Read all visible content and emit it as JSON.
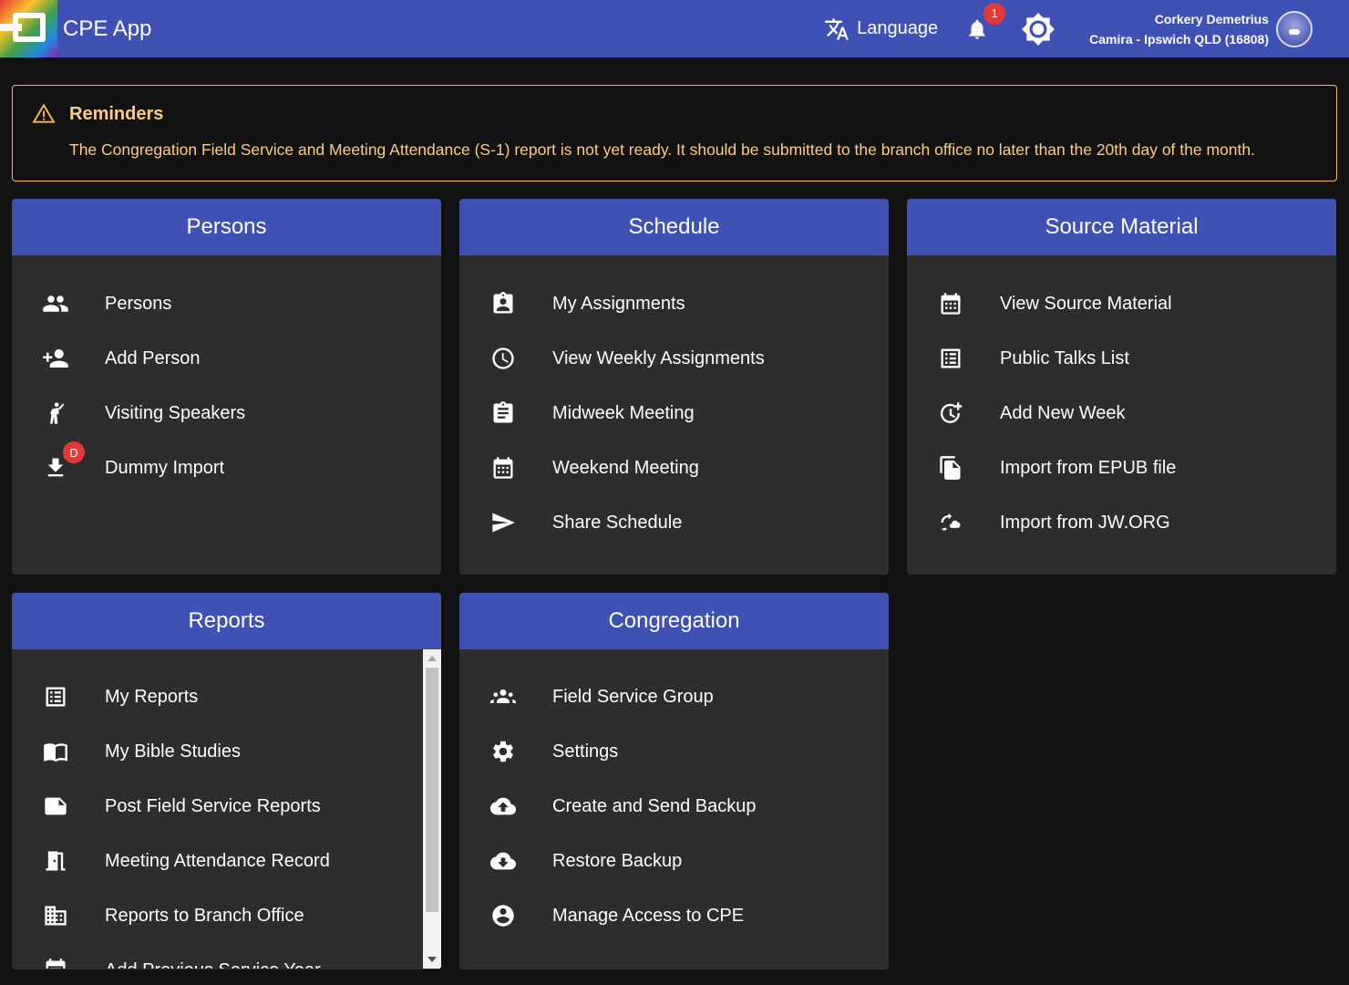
{
  "header": {
    "app_title": "CPE App",
    "language_label": "Language",
    "notification_count": "1",
    "user_name": "Corkery Demetrius",
    "user_congregation": "Camira - Ipswich QLD (16808)"
  },
  "reminder": {
    "title": "Reminders",
    "text": "The Congregation Field Service and Meeting Attendance (S-1) report is not yet ready. It should be submitted to the branch office no later than the 20th day of the month."
  },
  "cards": {
    "persons": {
      "title": "Persons",
      "items": [
        {
          "label": "Persons",
          "icon": "people-icon"
        },
        {
          "label": "Add Person",
          "icon": "person-add-icon"
        },
        {
          "label": "Visiting Speakers",
          "icon": "speaker-icon"
        },
        {
          "label": "Dummy Import",
          "icon": "download-icon",
          "badge": "D"
        }
      ]
    },
    "schedule": {
      "title": "Schedule",
      "items": [
        {
          "label": "My Assignments",
          "icon": "assignment-ind-icon"
        },
        {
          "label": "View Weekly Assignments",
          "icon": "clock-icon"
        },
        {
          "label": "Midweek Meeting",
          "icon": "clipboard-icon"
        },
        {
          "label": "Weekend Meeting",
          "icon": "calendar-icon"
        },
        {
          "label": "Share Schedule",
          "icon": "send-icon"
        }
      ]
    },
    "source": {
      "title": "Source Material",
      "items": [
        {
          "label": "View Source Material",
          "icon": "calendar-icon"
        },
        {
          "label": "Public Talks List",
          "icon": "list-icon"
        },
        {
          "label": "Add New Week",
          "icon": "add-alarm-icon"
        },
        {
          "label": "Import from EPUB file",
          "icon": "file-copy-icon"
        },
        {
          "label": "Import from JW.ORG",
          "icon": "cloud-sync-icon"
        }
      ]
    },
    "reports": {
      "title": "Reports",
      "items": [
        {
          "label": "My Reports",
          "icon": "list-icon"
        },
        {
          "label": "My Bible Studies",
          "icon": "book-icon"
        },
        {
          "label": "Post Field Service Reports",
          "icon": "note-icon"
        },
        {
          "label": "Meeting Attendance Record",
          "icon": "door-icon"
        },
        {
          "label": "Reports to Branch Office",
          "icon": "building-icon"
        },
        {
          "label": "Add Previous Service Year",
          "icon": "add-calendar-icon"
        }
      ]
    },
    "congregation": {
      "title": "Congregation",
      "items": [
        {
          "label": "Field Service Group",
          "icon": "groups-icon"
        },
        {
          "label": "Settings",
          "icon": "settings-icon"
        },
        {
          "label": "Create and Send Backup",
          "icon": "cloud-upload-icon"
        },
        {
          "label": "Restore Backup",
          "icon": "cloud-download-icon"
        },
        {
          "label": "Manage Access to CPE",
          "icon": "account-circle-icon"
        }
      ]
    }
  },
  "colors": {
    "primary": "#3f51b5",
    "card_bg": "#2d2d2d",
    "page_bg": "#121212",
    "warning": "#ffb74d",
    "badge": "#e53935"
  }
}
